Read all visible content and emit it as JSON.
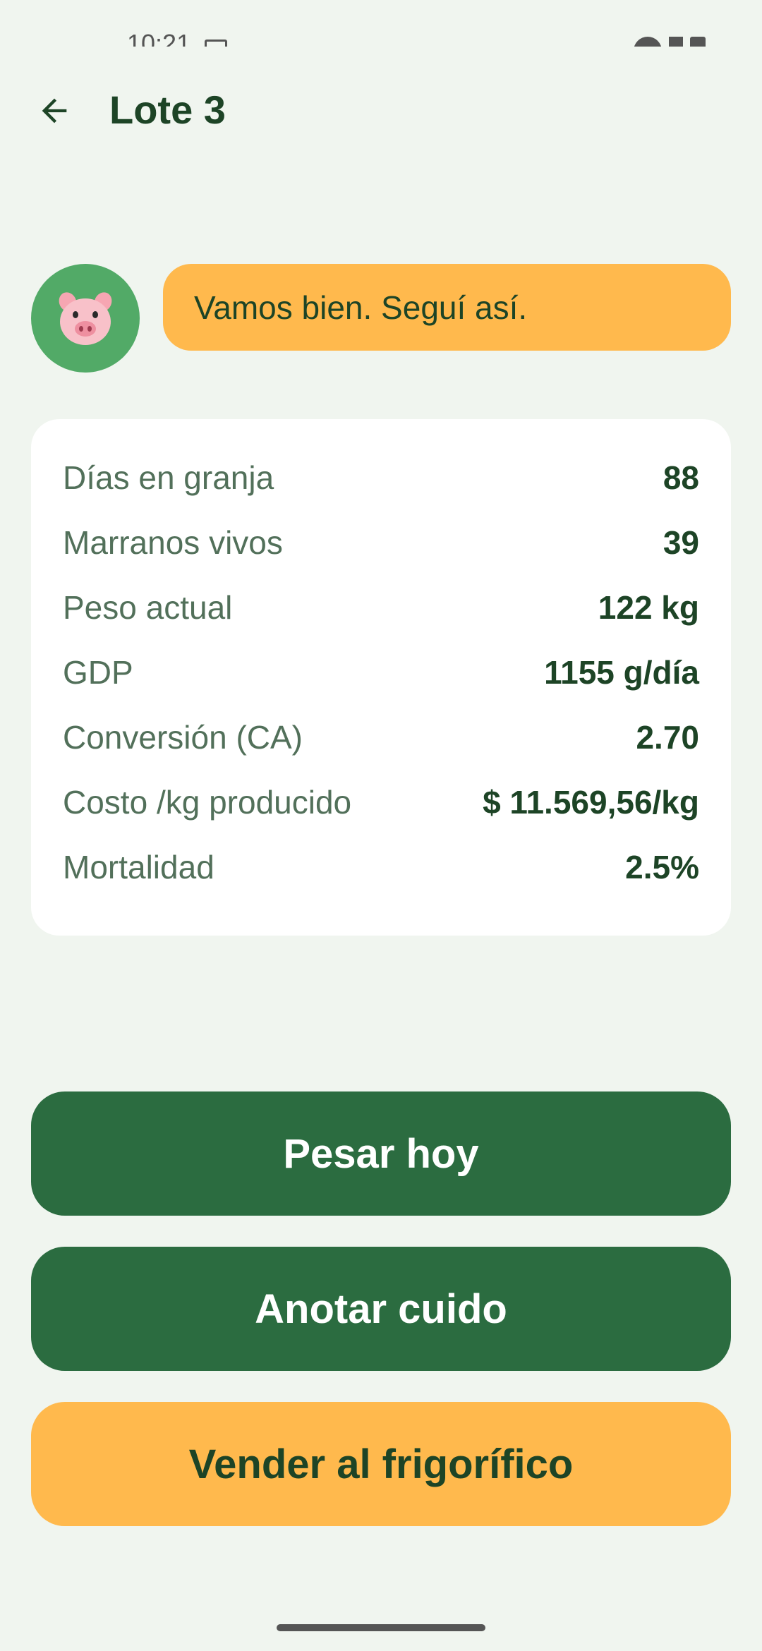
{
  "status_bar": {
    "time": "10:21"
  },
  "header": {
    "title": "Lote 3",
    "back_icon": "arrow-left-icon"
  },
  "mascot": {
    "icon": "pig-face-icon",
    "message": "Vamos bien. Seguí así.",
    "colors": {
      "avatar_bg": "#52AA67",
      "bubble_bg": "#FFB94D"
    }
  },
  "stats": [
    {
      "label": "Días en granja",
      "value": "88"
    },
    {
      "label": "Marranos vivos",
      "value": "39"
    },
    {
      "label": "Peso actual",
      "value": "122 kg"
    },
    {
      "label": "GDP",
      "value": "1155 g/día"
    },
    {
      "label": "Conversión (CA)",
      "value": "2.70"
    },
    {
      "label": "Costo /kg producido",
      "value": "$ 11.569,56/kg"
    },
    {
      "label": "Mortalidad",
      "value": "2.5%"
    }
  ],
  "actions": {
    "weigh_label": "Pesar hoy",
    "feed_label": "Anotar cuido",
    "sell_label": "Vender al frigorífico"
  },
  "colors": {
    "background": "#F0F5EF",
    "primary": "#2B6C40",
    "accent": "#FFB94D",
    "text": "#1D4426"
  }
}
